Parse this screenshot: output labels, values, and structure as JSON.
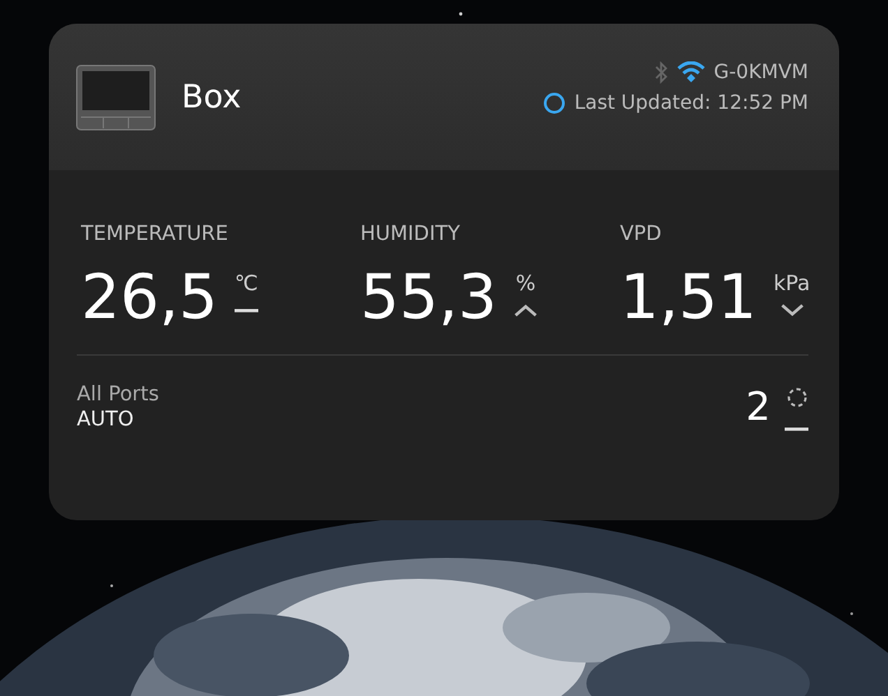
{
  "device": {
    "name": "Box",
    "network": "G-0KMVM",
    "last_updated": "Last Updated: 12:52 PM"
  },
  "readings": [
    {
      "label": "TEMPERATURE",
      "value": "26,5",
      "unit": "℃",
      "kind": "flat"
    },
    {
      "label": "HUMIDITY",
      "value": "55,3",
      "unit": "%",
      "kind": "up"
    },
    {
      "label": "VPD",
      "value": "1,51",
      "unit": "kPa",
      "kind": "down"
    }
  ],
  "ports": {
    "label": "All Ports",
    "mode": "AUTO",
    "level_value": "2",
    "kind": "flat"
  }
}
